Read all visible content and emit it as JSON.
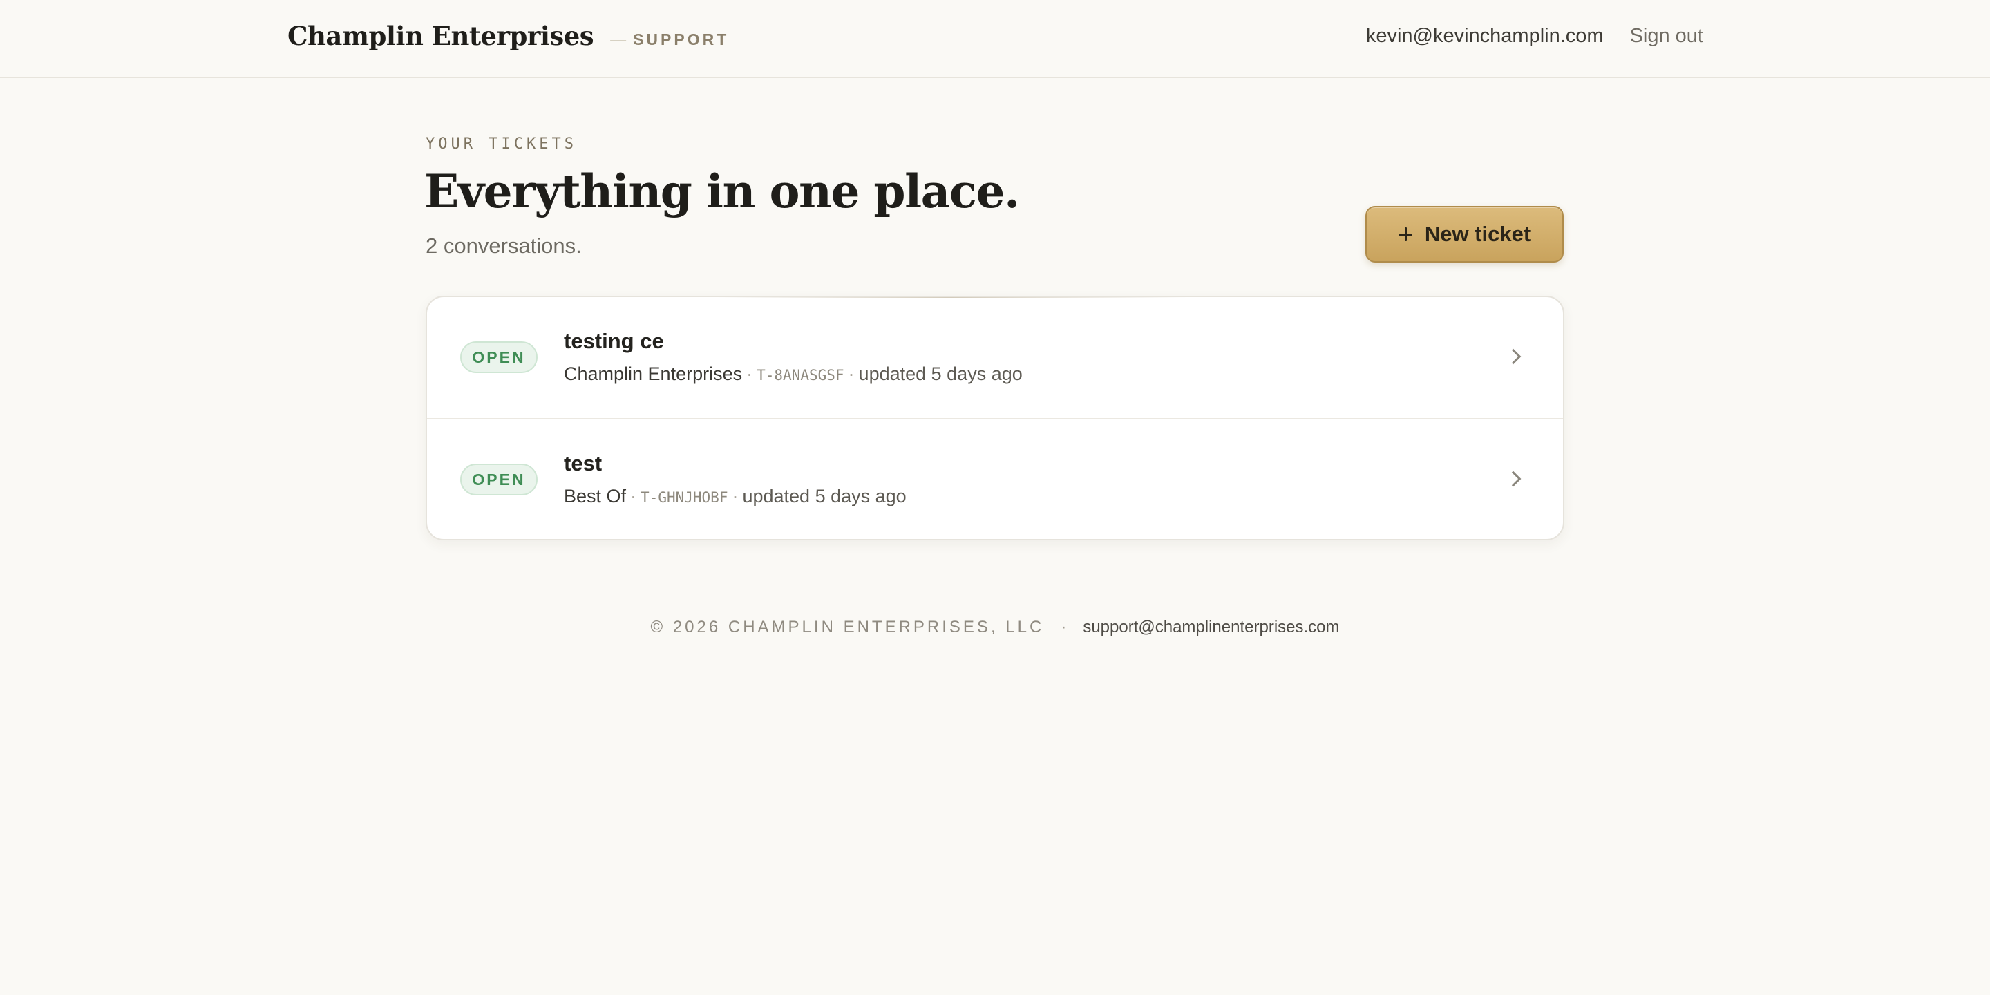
{
  "header": {
    "brand_name": "Champlin Enterprises",
    "brand_dash": "—",
    "brand_sub": "SUPPORT",
    "user_email": "kevin@kevinchamplin.com",
    "sign_out": "Sign out"
  },
  "intro": {
    "eyebrow": "YOUR TICKETS",
    "title": "Everything in one place.",
    "count_text": "2 conversations."
  },
  "actions": {
    "new_ticket": "New ticket"
  },
  "tickets": [
    {
      "status": "OPEN",
      "title": "testing ce",
      "company": "Champlin Enterprises",
      "id": "T-8ANASGSF",
      "updated": "updated 5 days ago"
    },
    {
      "status": "OPEN",
      "title": "test",
      "company": "Best Of",
      "id": "T-GHNJHOBF",
      "updated": "updated 5 days ago"
    }
  ],
  "footer": {
    "copyright": "© 2026 CHAMPLIN ENTERPRISES, LLC",
    "separator": "·",
    "support_email": "support@champlinenterprises.com"
  },
  "colors": {
    "background": "#faf9f5",
    "accent_gold": "#d4b06c",
    "status_open": "#3f8d55"
  }
}
